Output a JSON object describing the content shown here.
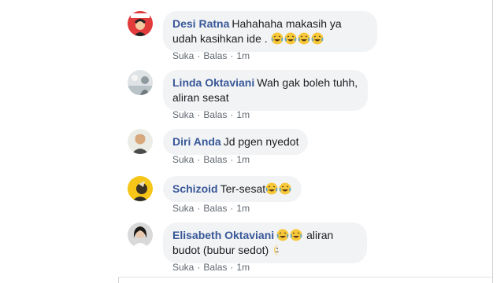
{
  "actions": {
    "like": "Suka",
    "reply": "Balas",
    "separator": "·"
  },
  "comments": [
    {
      "author": "Desi Ratna",
      "text": "Hahahaha makasih ya udah kasihkan ide .",
      "emojis": [
        "laughing-tears",
        "laughing-tears",
        "laughing-tears",
        "laughing-tears"
      ],
      "time": "1m"
    },
    {
      "author": "Linda Oktaviani",
      "text": "Wah gak boleh tuhh, aliran sesat",
      "emojis": [],
      "time": "1m"
    },
    {
      "author": "Diri Anda",
      "text": "Jd pgen nyedot",
      "emojis": [],
      "time": "1m"
    },
    {
      "author": "Schizoid",
      "text": "Ter-sesat",
      "emojis": [
        "laughing-tears",
        "laughing-tears"
      ],
      "time": "1m"
    },
    {
      "author": "Elisabeth Oktaviani",
      "text": "aliran budot (bubur sedot)",
      "emojis": [
        "laughing-tears",
        "laughing-tears",
        "moon-face"
      ],
      "time": "1m"
    }
  ],
  "colors": {
    "author": "#385898",
    "bubble": "#f2f3f5",
    "meta": "#606770",
    "text": "#1c1e21"
  }
}
